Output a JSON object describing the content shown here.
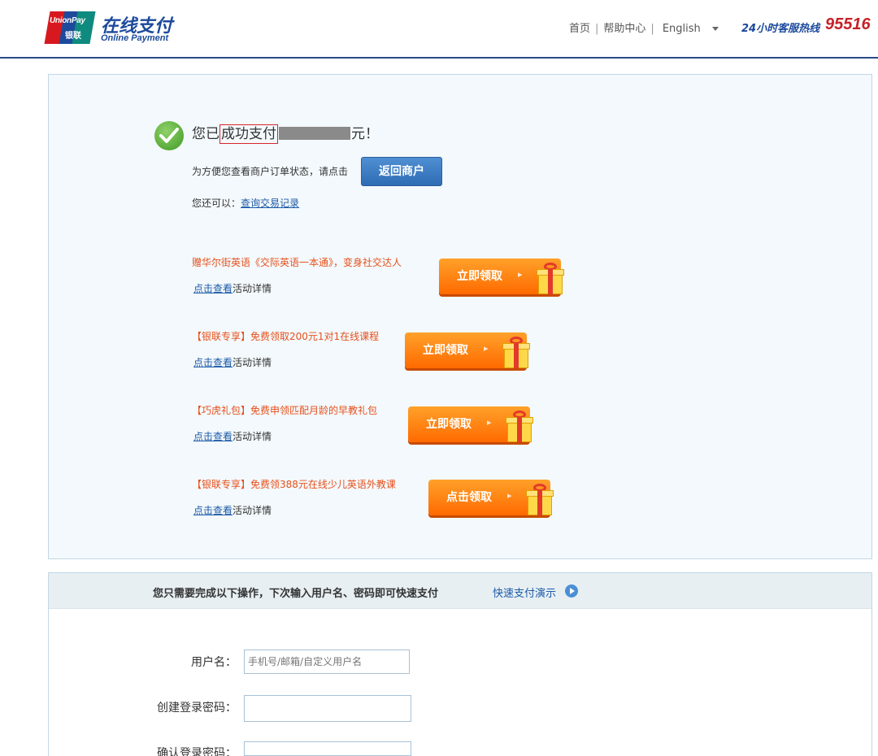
{
  "header": {
    "logo_en": "UnionPay",
    "logo_cn": "银联",
    "title": "在线支付",
    "subtitle": "Online Payment",
    "nav": [
      "首页",
      "帮助中心",
      "English"
    ],
    "hotline_label": "24小时客服热线",
    "hotline_number": "95516"
  },
  "result": {
    "prefix": "您已",
    "highlight": "成功支付",
    "suffix": "元！",
    "return_hint": "为方便您查看商户订单状态，请点击",
    "return_button": "返回商户",
    "also_label": "您还可以：",
    "history_link": "查询交易记录"
  },
  "promos": [
    {
      "title": "赠华尔街英语《交际英语一本通》，变身社交达人",
      "button": "立即领取",
      "link": "点击查看",
      "detail": "活动详情"
    },
    {
      "title": "【银联专享】免费领取200元1对1在线课程",
      "button": "立即领取",
      "link": "点击查看",
      "detail": "活动详情"
    },
    {
      "title": "【巧虎礼包】免费申领匹配月龄的早教礼包",
      "button": "立即领取",
      "link": "点击查看",
      "detail": "活动详情"
    },
    {
      "title": "【银联专享】免费领388元在线少儿英语外教课",
      "button": "点击领取",
      "link": "点击查看",
      "detail": "活动详情"
    }
  ],
  "quickpay": {
    "title": "您只需要完成以下操作，下次输入用户名、密码即可快速支付",
    "demo_link": "快速支付演示",
    "fields": [
      {
        "label": "用户名：",
        "placeholder": "手机号/邮箱/自定义用户名"
      },
      {
        "label": "创建登录密码：",
        "placeholder": ""
      },
      {
        "label": "确认登录密码：",
        "placeholder": ""
      }
    ]
  },
  "colors": {
    "brand_blue": "#1c4a9c",
    "hotline_red": "#c62127",
    "promo_orange": "#ff7a00",
    "link_blue": "#1d5aa8"
  }
}
